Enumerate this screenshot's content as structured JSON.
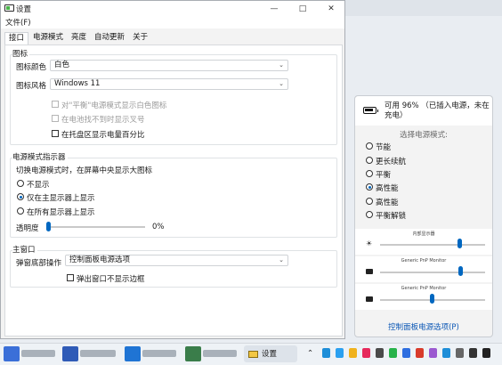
{
  "window": {
    "title": "设置",
    "menu_file": "文件(F)",
    "tabs": [
      "接口",
      "电源模式",
      "亮度",
      "自动更新",
      "关于"
    ],
    "active_tab": "接口"
  },
  "icon_section": {
    "title": "图标",
    "color_label": "图标颜色",
    "color_value": "白色",
    "style_label": "图标风格",
    "style_value": "Windows 11",
    "cb_balanced_white": "对\"平衡\"电源模式显示白色图标",
    "cb_no_charge_mark": "在电池找不到时显示叉号",
    "cb_tray_percent": "在托盘区显示电量百分比"
  },
  "indicator_section": {
    "title": "电源模式指示器",
    "desc": "切换电源模式时，在屏幕中央显示大图标",
    "opt_none": "不显示",
    "opt_primary": "仅在主显示器上显示",
    "opt_all": "在所有显示器上显示",
    "selected": "仅在主显示器上显示",
    "opacity_label": "透明度",
    "opacity_value": "0%",
    "opacity_fraction": 0
  },
  "main_window_section": {
    "title": "主窗口",
    "action_label": "弹窗底部操作",
    "action_value": "控制面板电源选项",
    "cb_no_border": "弹出窗口不显示边框"
  },
  "flyout": {
    "status": "可用 96% （已插入电源，未在充电）",
    "prompt": "选择电源模式:",
    "modes": [
      "节能",
      "更长续航",
      "平衡",
      "高性能",
      "高性能",
      "平衡解锁"
    ],
    "selected_index": 3,
    "displays": [
      {
        "label": "内部显示器",
        "level": 0.75
      },
      {
        "label": "Generic PnP Monitor",
        "level": 0.76
      },
      {
        "label": "Generic PnP Monitor",
        "level": 0.49
      }
    ],
    "link": "控制面板电源选项(P)"
  },
  "taskbar": {
    "active_app": "设置"
  },
  "colors": {
    "accent": "#0067c0",
    "link": "#0b57b5"
  }
}
